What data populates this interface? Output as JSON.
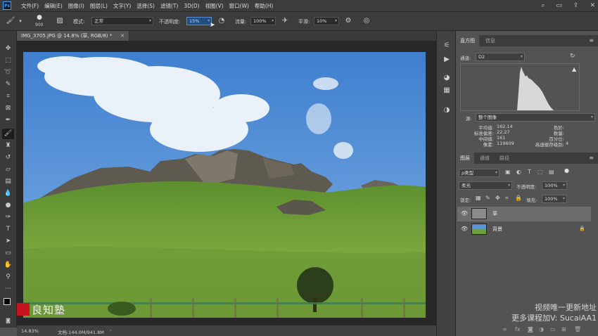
{
  "app": {
    "logo_text": "Ps"
  },
  "menu": {
    "items": [
      "文件(F)",
      "编辑(E)",
      "图像(I)",
      "图层(L)",
      "文字(Y)",
      "选择(S)",
      "滤镜(T)",
      "3D(D)",
      "视图(V)",
      "窗口(W)",
      "帮助(H)"
    ]
  },
  "options": {
    "brush_size": "900",
    "mode_label": "模式:",
    "mode_value": "正常",
    "opacity_label": "不透明度:",
    "opacity_value": "15%",
    "flow_label": "流量:",
    "flow_value": "100%",
    "smoothing_label": "平滑:",
    "smoothing_value": "10%"
  },
  "document": {
    "tab_title": "IMG_3705.JPG @ 14.8% (草, RGB/8) *",
    "zoom": "14.83%",
    "doc_size": "文档:144.0M/941.8M"
  },
  "histogram": {
    "tabs": [
      "直方图",
      "信息"
    ],
    "channel_label": "通道:",
    "channel_value": "D2",
    "source_label": "源:",
    "source_value": "整个图像",
    "stats": [
      {
        "label": "平均值:",
        "value": "162.14"
      },
      {
        "label": "标准偏差:",
        "value": "22.27"
      },
      {
        "label": "中间值:",
        "value": "161"
      },
      {
        "label": "像素:",
        "value": "119609"
      }
    ],
    "stats_right": [
      {
        "label": "色阶:",
        "value": ""
      },
      {
        "label": "数量:",
        "value": ""
      },
      {
        "label": "百分位:",
        "value": ""
      },
      {
        "label": "高速缓存级别:",
        "value": "4"
      }
    ]
  },
  "layers": {
    "tabs": [
      "图层",
      "通道",
      "路径"
    ],
    "filter_value": "ρ类型",
    "blend_mode": "柔光",
    "opacity_label": "不透明度:",
    "opacity_value": "100%",
    "lock_label": "锁定:",
    "fill_label": "填充:",
    "fill_value": "100%",
    "items": [
      {
        "name": "草",
        "selected": true
      },
      {
        "name": "背景",
        "selected": false
      }
    ]
  },
  "watermark": {
    "line1": "视频唯一更新地址",
    "line2": "更多课程加V: SucaiAA1"
  },
  "logo": {
    "text": "良知塾"
  },
  "colors": {
    "accent": "#31a8ff",
    "sky": "#5a93d6",
    "grass": "#6e9e3a"
  }
}
